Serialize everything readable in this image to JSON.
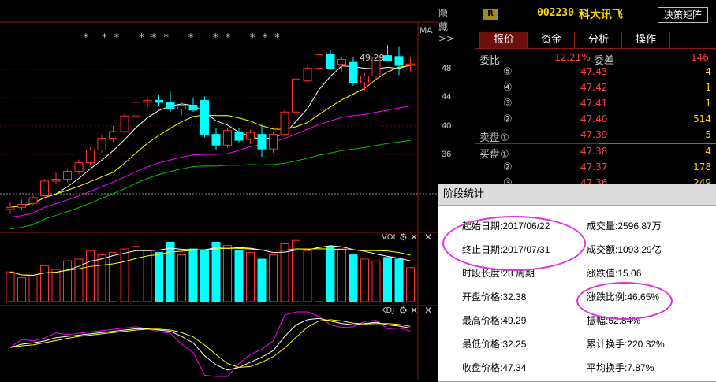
{
  "header": {
    "hide_label": "隐藏>>",
    "r_badge": "R",
    "code": "002230",
    "name": "科大讯飞",
    "decision_button": "决策矩阵"
  },
  "tabs": [
    "报价",
    "资金",
    "分析",
    "操作"
  ],
  "ratio": {
    "label1": "委比",
    "value1": "12.21%",
    "label2": "委差",
    "value2": "146"
  },
  "sell_orders": [
    {
      "label": "⑤",
      "price": "47.43",
      "vol": "4"
    },
    {
      "label": "④",
      "price": "47.42",
      "vol": "1"
    },
    {
      "label": "③",
      "price": "47.41",
      "vol": "1"
    },
    {
      "label": "②",
      "price": "47.40",
      "vol": "514"
    },
    {
      "label": "卖盘①",
      "price": "47.39",
      "vol": "5"
    }
  ],
  "buy_orders": [
    {
      "label": "买盘①",
      "price": "47.38",
      "vol": "4"
    },
    {
      "label": "②",
      "price": "47.37",
      "vol": "178"
    },
    {
      "label": "③",
      "price": "47.36",
      "vol": "249"
    }
  ],
  "price_chart": {
    "ma_label": "MA",
    "high_label": "49.29",
    "y_ticks": [
      "48",
      "44",
      "40",
      "36"
    ],
    "star_marks": "*  * *   * * *   *   * *   * * *"
  },
  "vol_panel": {
    "label": "VOL"
  },
  "kdj_panel": {
    "label": "KDJ"
  },
  "popup": {
    "title": "阶段统计",
    "left": [
      "起始日期:2017/06/22",
      "终止日期:2017/07/31",
      "时段长度:28 周期",
      "开盘价格:32.38",
      "最高价格:49.29",
      "最低价格:32.25",
      "收盘价格:47.34"
    ],
    "right": [
      "成交量:2596.87万",
      "成交额:1093.29亿",
      "涨跌值:15.06",
      "涨跌比例:46.65%",
      "振幅:52.84%",
      "累计换手:220.32%",
      "平均换手:7.87%"
    ]
  },
  "chart_data": {
    "type": "candlestick",
    "candles": [
      [
        32.38,
        33.2,
        31.9,
        32.6
      ],
      [
        32.6,
        33.4,
        32.3,
        32.9
      ],
      [
        33.0,
        34.0,
        32.8,
        33.6
      ],
      [
        33.8,
        35.5,
        33.6,
        35.3
      ],
      [
        35.3,
        36.2,
        35.0,
        35.5
      ],
      [
        35.5,
        36.5,
        35.2,
        36.3
      ],
      [
        36.3,
        37.5,
        36.0,
        37.2
      ],
      [
        37.2,
        38.8,
        37.0,
        38.5
      ],
      [
        38.5,
        40.0,
        38.2,
        39.7
      ],
      [
        39.7,
        41.0,
        39.3,
        40.4
      ],
      [
        40.4,
        42.2,
        40.2,
        42.0
      ],
      [
        42.0,
        43.6,
        41.8,
        43.4
      ],
      [
        43.4,
        43.9,
        42.8,
        43.6
      ],
      [
        43.6,
        44.2,
        43.0,
        43.4
      ],
      [
        43.4,
        44.6,
        42.4,
        42.7
      ],
      [
        42.7,
        43.4,
        42.1,
        43.1
      ],
      [
        43.1,
        43.9,
        42.4,
        42.6
      ],
      [
        43.6,
        44.0,
        39.8,
        40.1
      ],
      [
        40.1,
        40.8,
        38.5,
        39.0
      ],
      [
        39.0,
        40.8,
        38.7,
        40.5
      ],
      [
        40.3,
        40.8,
        39.3,
        39.5
      ],
      [
        39.6,
        40.6,
        39.1,
        40.3
      ],
      [
        40.1,
        41.1,
        37.8,
        38.6
      ],
      [
        38.6,
        40.4,
        38.2,
        40.1
      ],
      [
        40.1,
        42.6,
        39.9,
        42.4
      ],
      [
        42.4,
        46.2,
        42.1,
        45.8
      ],
      [
        45.6,
        47.2,
        45.3,
        46.9
      ],
      [
        46.9,
        48.6,
        46.4,
        48.3
      ],
      [
        48.3,
        48.8,
        46.7,
        46.9
      ],
      [
        47.3,
        48.1,
        46.6,
        47.8
      ],
      [
        47.5,
        48.0,
        45.1,
        45.4
      ],
      [
        45.4,
        46.4,
        44.6,
        46.1
      ],
      [
        46.1,
        48.1,
        45.8,
        48.0
      ],
      [
        48.2,
        49.29,
        47.6,
        47.7
      ],
      [
        48.1,
        49.1,
        46.2,
        47.2
      ],
      [
        47.2,
        48.0,
        46.6,
        47.34
      ]
    ],
    "volumes": [
      35,
      28,
      30,
      42,
      38,
      48,
      50,
      60,
      55,
      58,
      62,
      65,
      60,
      58,
      70,
      55,
      62,
      60,
      70,
      66,
      60,
      58,
      50,
      55,
      68,
      72,
      60,
      64,
      65,
      62,
      55,
      50,
      48,
      52,
      50,
      40
    ],
    "kdj": [
      0.45,
      0.5,
      0.52,
      0.55,
      0.6,
      0.62,
      0.64,
      0.66,
      0.68,
      0.7,
      0.72,
      0.74,
      0.74,
      0.72,
      0.7,
      0.62,
      0.52,
      0.32,
      0.18,
      0.1,
      0.14,
      0.22,
      0.3,
      0.4,
      0.62,
      0.8,
      0.88,
      0.9,
      0.86,
      0.82,
      0.8,
      0.82,
      0.84,
      0.8,
      0.78,
      0.75
    ],
    "ylim": [
      34,
      51
    ]
  }
}
